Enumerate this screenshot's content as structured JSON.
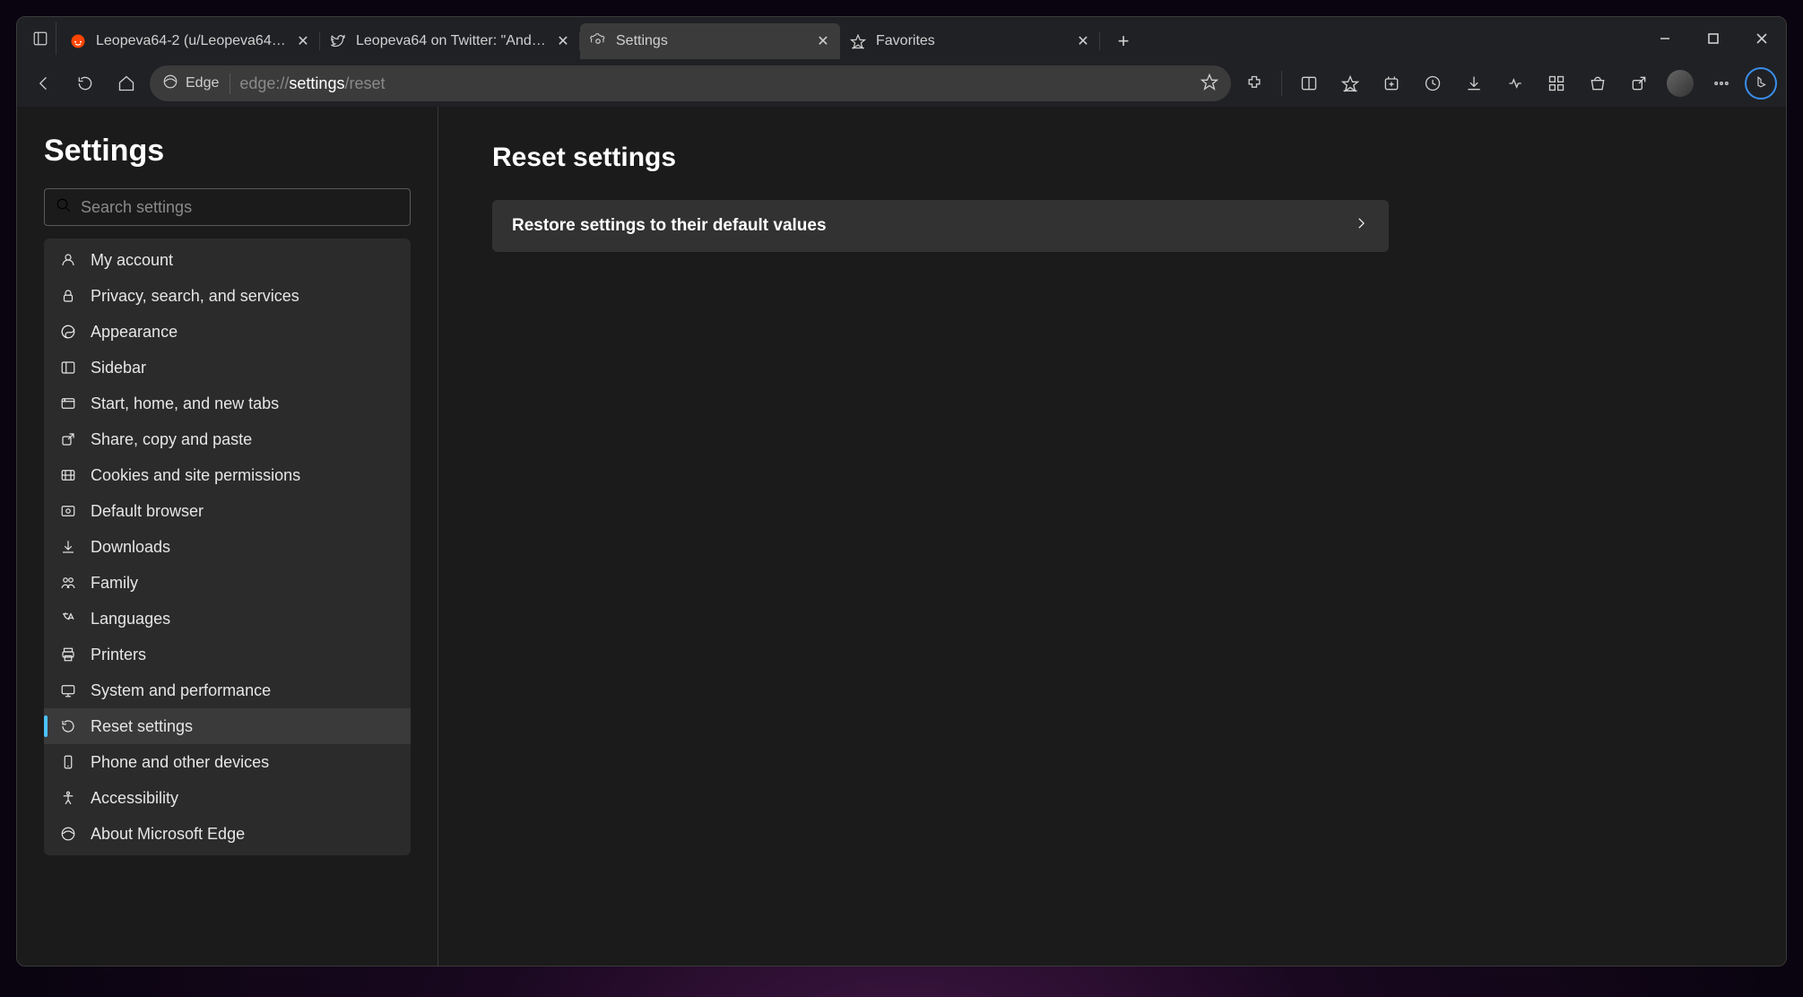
{
  "tabs": [
    {
      "title": "Leopeva64-2 (u/Leopeva64-2) - R",
      "icon": "reddit"
    },
    {
      "title": "Leopeva64 on Twitter: \"And here",
      "icon": "twitter"
    },
    {
      "title": "Settings",
      "icon": "settings",
      "active": true
    },
    {
      "title": "Favorites",
      "icon": "favorites"
    }
  ],
  "addressbar": {
    "site_label": "Edge",
    "url_prefix": "edge://",
    "url_active": "settings",
    "url_suffix": "/reset"
  },
  "sidebar": {
    "title": "Settings",
    "search_placeholder": "Search settings",
    "items": [
      {
        "label": "My account",
        "icon": "account"
      },
      {
        "label": "Privacy, search, and services",
        "icon": "lock"
      },
      {
        "label": "Appearance",
        "icon": "appearance"
      },
      {
        "label": "Sidebar",
        "icon": "sidebar"
      },
      {
        "label": "Start, home, and new tabs",
        "icon": "home-tab"
      },
      {
        "label": "Share, copy and paste",
        "icon": "share"
      },
      {
        "label": "Cookies and site permissions",
        "icon": "cookies"
      },
      {
        "label": "Default browser",
        "icon": "default-browser"
      },
      {
        "label": "Downloads",
        "icon": "download"
      },
      {
        "label": "Family",
        "icon": "family"
      },
      {
        "label": "Languages",
        "icon": "languages"
      },
      {
        "label": "Printers",
        "icon": "printer"
      },
      {
        "label": "System and performance",
        "icon": "system"
      },
      {
        "label": "Reset settings",
        "icon": "reset",
        "active": true
      },
      {
        "label": "Phone and other devices",
        "icon": "phone"
      },
      {
        "label": "Accessibility",
        "icon": "accessibility"
      },
      {
        "label": "About Microsoft Edge",
        "icon": "edge"
      }
    ]
  },
  "main": {
    "title": "Reset settings",
    "restore_label": "Restore settings to their default values"
  }
}
